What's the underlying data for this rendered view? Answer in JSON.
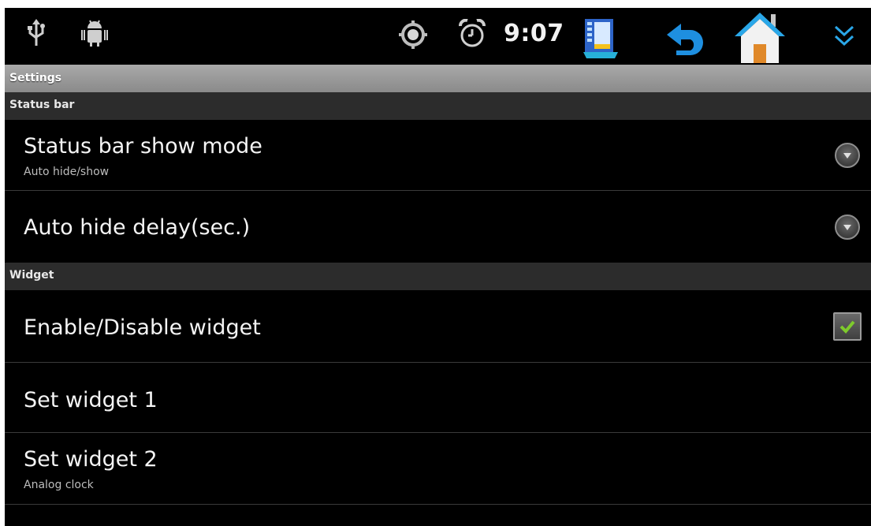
{
  "status_bar": {
    "time": "9:07",
    "icons": [
      "usb-icon",
      "android-debug-icon",
      "gps-icon",
      "alarm-icon",
      "app-switcher-icon",
      "back-icon",
      "home-icon",
      "expand-chevron-icon"
    ]
  },
  "title_bar": {
    "title": "Settings"
  },
  "categories": {
    "status_bar": "Status bar",
    "widget": "Widget"
  },
  "settings": {
    "status_bar_show_mode": {
      "title": "Status bar show mode",
      "summary": "Auto hide/show"
    },
    "auto_hide_delay": {
      "title": "Auto hide delay(sec.)"
    },
    "enable_widget": {
      "title": "Enable/Disable widget",
      "checked": true
    },
    "set_widget_1": {
      "title": "Set widget 1"
    },
    "set_widget_2": {
      "title": "Set widget 2",
      "summary": "Analog clock"
    }
  },
  "colors": {
    "accent_check": "#7ecb2c",
    "back_arrow": "#1e8fe0",
    "chevron": "#2aa7e8"
  }
}
